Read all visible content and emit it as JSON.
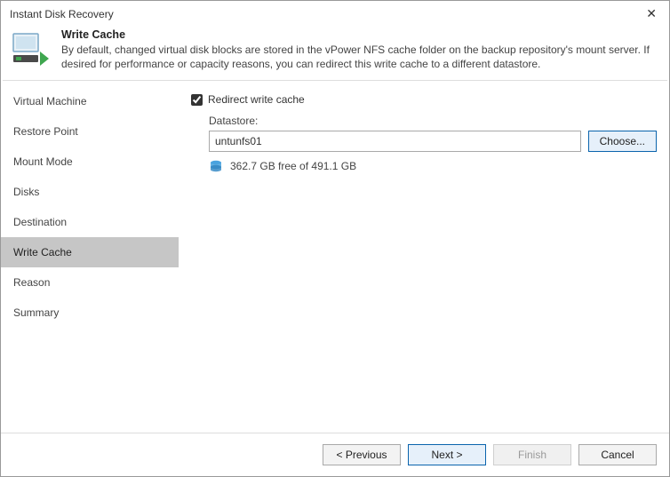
{
  "window": {
    "title": "Instant Disk Recovery"
  },
  "header": {
    "title": "Write Cache",
    "description": "By default, changed virtual disk blocks are stored in the vPower NFS cache folder on the backup repository's mount server. If desired for performance or capacity reasons, you can redirect this write cache to a different datastore."
  },
  "sidebar": {
    "items": [
      {
        "label": "Virtual Machine"
      },
      {
        "label": "Restore Point"
      },
      {
        "label": "Mount Mode"
      },
      {
        "label": "Disks"
      },
      {
        "label": "Destination"
      },
      {
        "label": "Write Cache"
      },
      {
        "label": "Reason"
      },
      {
        "label": "Summary"
      }
    ],
    "activeIndex": 5
  },
  "content": {
    "redirectCheckbox": {
      "label": "Redirect write cache",
      "checked": true
    },
    "datastoreLabel": "Datastore:",
    "datastoreValue": "untunfs01",
    "chooseButton": "Choose...",
    "freeSpace": "362.7 GB free of 491.1 GB"
  },
  "footer": {
    "previous": "< Previous",
    "next": "Next >",
    "finish": "Finish",
    "cancel": "Cancel"
  }
}
